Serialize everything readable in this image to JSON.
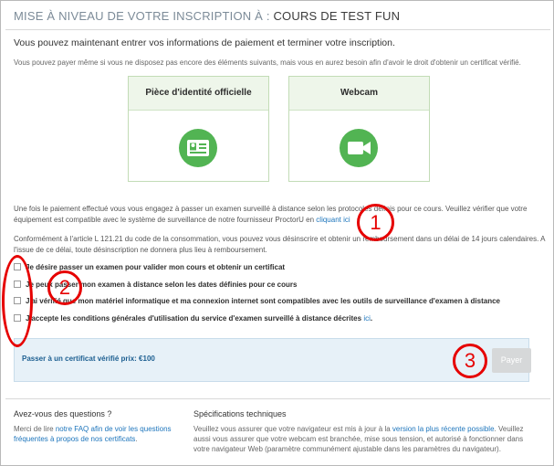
{
  "header": {
    "prefix": "MISE À NIVEAU DE VOTRE INSCRIPTION À :",
    "course": "COURS DE TEST FUN"
  },
  "intro": "Vous pouvez maintenant entrer vos informations de paiement et terminer votre inscription.",
  "note": "Vous pouvez payer même si vous ne disposez pas encore des éléments suivants, mais vous en aurez besoin afin d'avoir le droit d'obtenir un certificat vérifié.",
  "cards": [
    {
      "title": "Pièce d'identité officielle",
      "icon": "id-card-icon"
    },
    {
      "title": "Webcam",
      "icon": "video-camera-icon"
    }
  ],
  "para1": {
    "text": "Une fois le paiement effectué vous vous engagez à passer un examen surveillé à distance selon les protocoles définis pour ce cours. Veuillez vérifier que votre équipement est compatible avec le système de surveillance de notre fournisseur ProctorU en",
    "link": "cliquant ici"
  },
  "para2": "Conformément à l'article L 121.21 du code de la consommation, vous pouvez vous désinscrire et obtenir un remboursement dans un délai de 14 jours calendaires. A l'issue de ce délai, toute désinscription ne donnera plus lieu à remboursement.",
  "checks": [
    {
      "label": "Je désire passer un examen pour valider mon cours et obtenir un certificat"
    },
    {
      "label": "Je peux passer mon examen à distance selon les dates définies pour ce cours"
    },
    {
      "label": "J'ai vérifié que mon matériel informatique et ma connexion internet sont compatibles avec les outils de surveillance d'examen à distance"
    },
    {
      "label": "J'accepte les conditions générales d'utilisation du service d'examen surveillé à distance décrites",
      "link": "ici"
    }
  ],
  "payment": {
    "label": "Passer à un certificat vérifié prix: €100",
    "button": "Payer"
  },
  "footer": {
    "questions": {
      "title": "Avez-vous des questions ?",
      "pre": "Merci de lire",
      "link": "notre FAQ afin de voir les questions fréquentes à propos de nos certificats",
      "post": "."
    },
    "specs": {
      "title": "Spécifications techniques",
      "pre": "Veuillez vous assurer que votre navigateur est mis à jour à la",
      "link": "version la plus récente possible",
      "post": ". Veuillez aussi vous assurer que votre webcam est branchée, mise sous tension, et autorisé à fonctionner dans votre navigateur Web (paramètre communément ajustable dans les paramètres du navigateur)."
    }
  },
  "annotations": [
    "1",
    "2",
    "3"
  ],
  "colors": {
    "annotation": "#e60000",
    "accent_green": "#52b453",
    "link": "#1d75bc"
  }
}
